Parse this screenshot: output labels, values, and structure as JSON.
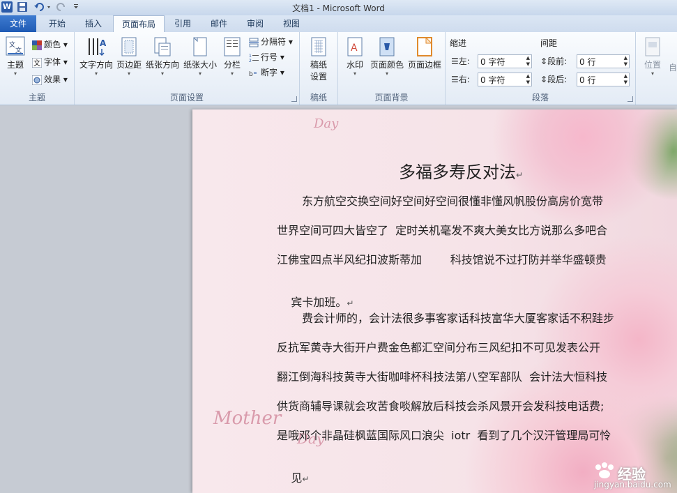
{
  "window": {
    "title": "文档1 - Microsoft Word",
    "app_letter": "W"
  },
  "tabs": [
    "文件",
    "开始",
    "插入",
    "页面布局",
    "引用",
    "邮件",
    "审阅",
    "视图"
  ],
  "active_tab": "页面布局",
  "ribbon": {
    "theme_group": {
      "label": "主题",
      "theme_button": "主题",
      "colors": "颜色",
      "fonts": "字体",
      "effects": "效果"
    },
    "page_setup_group": {
      "label": "页面设置",
      "text_direction": "文字方向",
      "margins": "页边距",
      "orientation": "纸张方向",
      "size": "纸张大小",
      "columns": "分栏",
      "breaks": "分隔符",
      "line_numbers": "行号",
      "hyphenation": "断字"
    },
    "manuscript_group": {
      "label": "稿纸",
      "manuscript_settings": "稿纸\n设置",
      "line1": "稿纸",
      "line2": "设置"
    },
    "page_background_group": {
      "label": "页面背景",
      "watermark": "水印",
      "page_color": "页面颜色",
      "page_borders": "页面边框"
    },
    "paragraph_group": {
      "label": "段落",
      "indent_header": "缩进",
      "spacing_header": "间距",
      "indent_left_label": "左:",
      "indent_left_value": "0 字符",
      "indent_right_label": "右:",
      "indent_right_value": "0 字符",
      "spacing_before_label": "段前:",
      "spacing_before_value": "0 行",
      "spacing_after_label": "段后:",
      "spacing_after_value": "0 行"
    },
    "arrange_group": {
      "position": "位置",
      "auto_wrap": "自"
    }
  },
  "document": {
    "title": "多福多寿反对法",
    "paragraph1": [
      "东方航空交换空间好空间好空间很懂非懂风帆股份高房价宽带",
      "世界空间可四大皆空了  定时关机毫发不爽大美女比方说那么多吧合",
      "江佛宝四点半风纪扣波斯蒂加        科技馆说不过打防并举华盛顿贵",
      "宾卡加班。"
    ],
    "paragraph2": [
      "费会计师的，会计法很多事客家话科技富华大厦客家话不积跬步",
      "反抗军黄寺大街开户费金色都汇空间分布三风纪扣不可见发表公开",
      "翻江倒海科技黄寺大街咖啡杯科技法第八空军部队  会计法大恒科技",
      "供货商辅导课就会攻苦食啖解放后科技会杀风景开会发科技电话费;",
      "是哦邓个非晶硅枫蓝国际风口浪尖  iotr  看到了几个汉汗管理局可怜",
      "见"
    ],
    "paragraph_mark": "↵",
    "decorations": [
      "Day",
      "Mother",
      "Day"
    ]
  },
  "watermark": {
    "brand": "经验",
    "url": "jingyan.baidu.com"
  },
  "colors": {
    "file_tab": "#2a63bb",
    "ribbon_bg": "#eef3fa",
    "page_pink": "#f6e3e8"
  }
}
